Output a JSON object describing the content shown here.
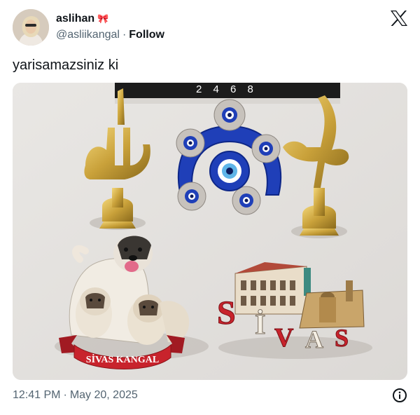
{
  "author": {
    "display_name": "aslihan",
    "emoji": "🎀",
    "handle": "@asliikangal",
    "separator": "·",
    "follow_label": "Follow"
  },
  "tweet": {
    "text": "yarisamazsiniz ki"
  },
  "media": {
    "calendar_digits": "2 4 6 8",
    "kangal_banner": "SİVAS KANGAL",
    "sivas_letters": [
      "S",
      "İ",
      "V",
      "A",
      "S"
    ]
  },
  "footer": {
    "time": "12:41 PM",
    "separator": "·",
    "date": "May 20, 2025"
  },
  "icons": {
    "brand": "x-logo-icon",
    "info": "info-icon"
  },
  "colors": {
    "text_primary": "#0f1419",
    "text_secondary": "#536471",
    "evil_eye_blue": "#1f3fb8",
    "gold": "#c9a13a",
    "banner_red": "#c8232c"
  }
}
